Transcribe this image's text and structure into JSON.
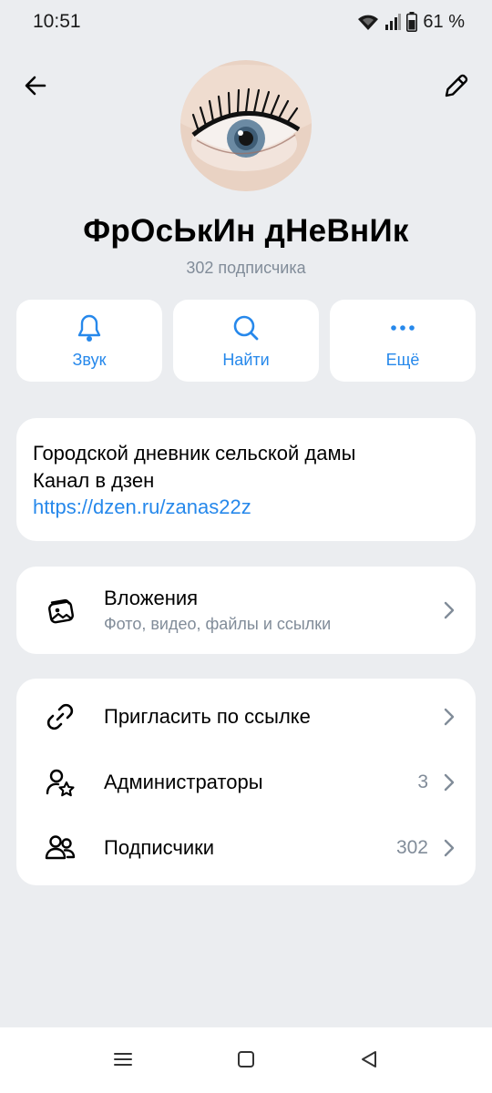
{
  "status_bar": {
    "time": "10:51",
    "battery": "61 %"
  },
  "header": {
    "back_icon": "arrow-left-icon",
    "edit_icon": "pencil-icon"
  },
  "channel": {
    "title": "ФрОсЬкИн дНеВнИк",
    "subscribers": "302 подписчика"
  },
  "actions": [
    {
      "label": "Звук",
      "icon": "bell-icon"
    },
    {
      "label": "Найти",
      "icon": "search-icon"
    },
    {
      "label": "Ещё",
      "icon": "more-icon"
    }
  ],
  "description": {
    "line1": "Городской дневник сельской дамы",
    "line2": "Канал в дзен",
    "link": "https://dzen.ru/zanas22z"
  },
  "attachments": {
    "title": "Вложения",
    "subtitle": "Фото, видео, файлы и ссылки"
  },
  "menu": {
    "invite": {
      "label": "Пригласить по ссылке"
    },
    "admins": {
      "label": "Администраторы",
      "count": "3"
    },
    "subscribers": {
      "label": "Подписчики",
      "count": "302"
    }
  },
  "colors": {
    "accent": "#2688eb",
    "background": "#ebedf0",
    "secondary_text": "#818c99"
  }
}
